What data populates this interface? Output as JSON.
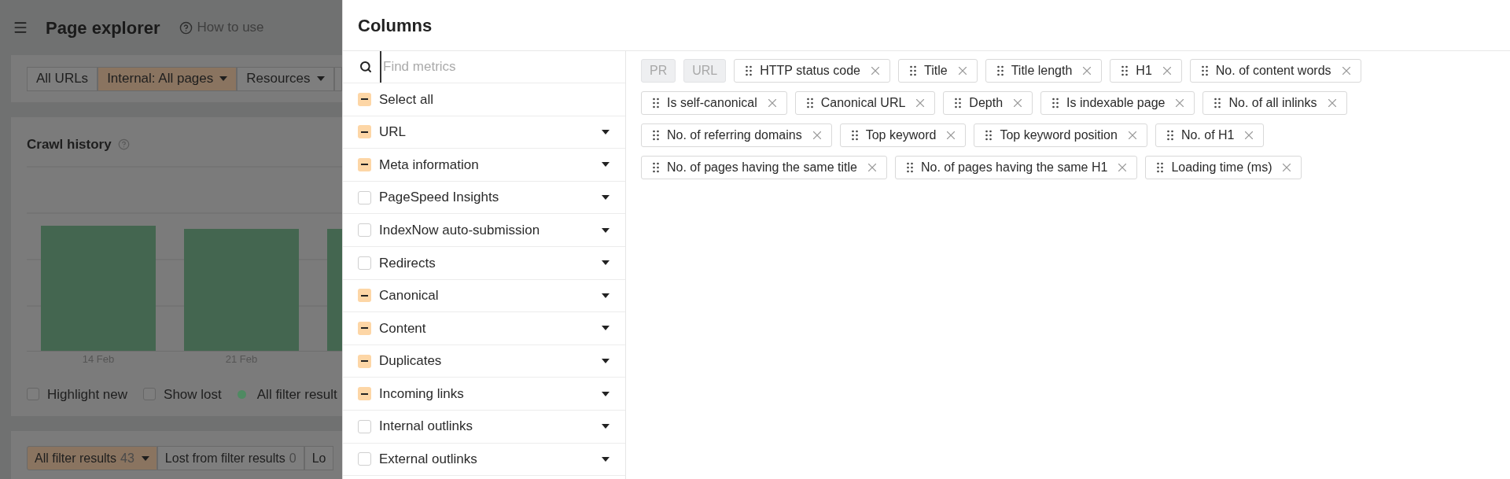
{
  "background_page": {
    "title": "Page explorer",
    "help_link": "How to use",
    "filter_tabs": [
      {
        "label": "All URLs",
        "selected": false,
        "dropdown": false
      },
      {
        "label": "Internal: All pages",
        "selected": true,
        "dropdown": true
      },
      {
        "label": "Resources",
        "selected": false,
        "dropdown": true
      }
    ],
    "crawl_history": {
      "title": "Crawl history",
      "x_labels": [
        "14 Feb",
        "21 Feb"
      ],
      "legend": [
        {
          "kind": "checkbox",
          "label": "Highlight new",
          "checked": false
        },
        {
          "kind": "checkbox",
          "label": "Show lost",
          "checked": false
        },
        {
          "kind": "dot",
          "label": "All filter result",
          "color": "#4f8a62"
        }
      ]
    },
    "result_tabs": [
      {
        "label": "All filter results",
        "count": "43",
        "selected": true,
        "dropdown": true
      },
      {
        "label": "Lost from filter results",
        "count": "0",
        "selected": false,
        "dropdown": false
      },
      {
        "label": "Lo",
        "selected": false,
        "dropdown": false
      }
    ]
  },
  "columns_panel": {
    "title": "Columns",
    "search": {
      "placeholder": "Find metrics"
    },
    "groups": [
      {
        "label": "Select all",
        "indeterminate": true,
        "expandable": false
      },
      {
        "label": "URL",
        "indeterminate": true,
        "expandable": true
      },
      {
        "label": "Meta information",
        "indeterminate": true,
        "expandable": true
      },
      {
        "label": "PageSpeed Insights",
        "indeterminate": false,
        "expandable": true
      },
      {
        "label": "IndexNow auto-submission",
        "indeterminate": false,
        "expandable": true
      },
      {
        "label": "Redirects",
        "indeterminate": false,
        "expandable": true
      },
      {
        "label": "Canonical",
        "indeterminate": true,
        "expandable": true
      },
      {
        "label": "Content",
        "indeterminate": true,
        "expandable": true
      },
      {
        "label": "Duplicates",
        "indeterminate": true,
        "expandable": true
      },
      {
        "label": "Incoming links",
        "indeterminate": true,
        "expandable": true
      },
      {
        "label": "Internal outlinks",
        "indeterminate": false,
        "expandable": true
      },
      {
        "label": "External outlinks",
        "indeterminate": false,
        "expandable": true
      }
    ],
    "columns": [
      {
        "label": "PR",
        "locked": true
      },
      {
        "label": "URL",
        "locked": true
      },
      {
        "label": "HTTP status code",
        "locked": false
      },
      {
        "label": "Title",
        "locked": false
      },
      {
        "label": "Title length",
        "locked": false
      },
      {
        "label": "H1",
        "locked": false
      },
      {
        "label": "No. of content words",
        "locked": false
      },
      {
        "label": "Is self-canonical",
        "locked": false
      },
      {
        "label": "Canonical URL",
        "locked": false
      },
      {
        "label": "Depth",
        "locked": false
      },
      {
        "label": "Is indexable page",
        "locked": false
      },
      {
        "label": "No. of all inlinks",
        "locked": false
      },
      {
        "label": "No. of referring domains",
        "locked": false
      },
      {
        "label": "Top keyword",
        "locked": false
      },
      {
        "label": "Top keyword position",
        "locked": false
      },
      {
        "label": "No. of H1",
        "locked": false
      },
      {
        "label": "No. of pages having the same title",
        "locked": false
      },
      {
        "label": "No. of pages having the same H1",
        "locked": false
      },
      {
        "label": "Loading time (ms)",
        "locked": false
      }
    ]
  }
}
